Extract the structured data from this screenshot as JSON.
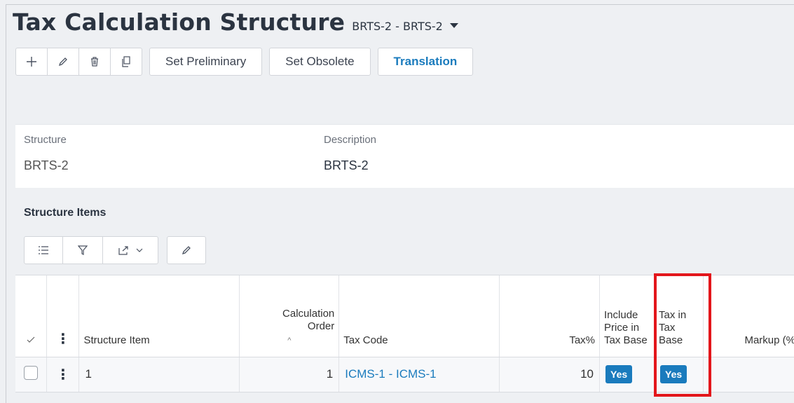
{
  "header": {
    "title": "Tax Calculation Structure",
    "subtitle": "BRTS-2 - BRTS-2"
  },
  "toolbar": {
    "icons": [
      "plus-icon",
      "pencil-icon",
      "trash-icon",
      "copy-icon"
    ],
    "set_preliminary": "Set Preliminary",
    "set_obsolete": "Set Obsolete",
    "translation": "Translation"
  },
  "details": {
    "structure_label": "Structure",
    "structure_value": "BRTS-2",
    "description_label": "Description",
    "description_value": "BRTS-2"
  },
  "items_section": {
    "title": "Structure Items",
    "tools": [
      "list-icon",
      "filter-icon",
      "export-icon",
      "pencil-icon"
    ]
  },
  "table": {
    "headers": {
      "structure_item": "Structure Item",
      "calc_order_line1": "Calculation",
      "calc_order_line2": "Order",
      "tax_code": "Tax Code",
      "tax_pct": "Tax%",
      "include_price": "Include Price in Tax Base",
      "tax_in_tax": "Tax in Tax Base",
      "markup": "Markup (%"
    },
    "rows": [
      {
        "structure_item": "1",
        "calc_order": "1",
        "tax_code": "ICMS-1 - ICMS-1",
        "tax_pct": "10",
        "include_price": "Yes",
        "tax_in_tax": "Yes",
        "markup": ""
      }
    ]
  },
  "colors": {
    "accent": "#1a7bbd",
    "highlight": "#e3161b"
  }
}
